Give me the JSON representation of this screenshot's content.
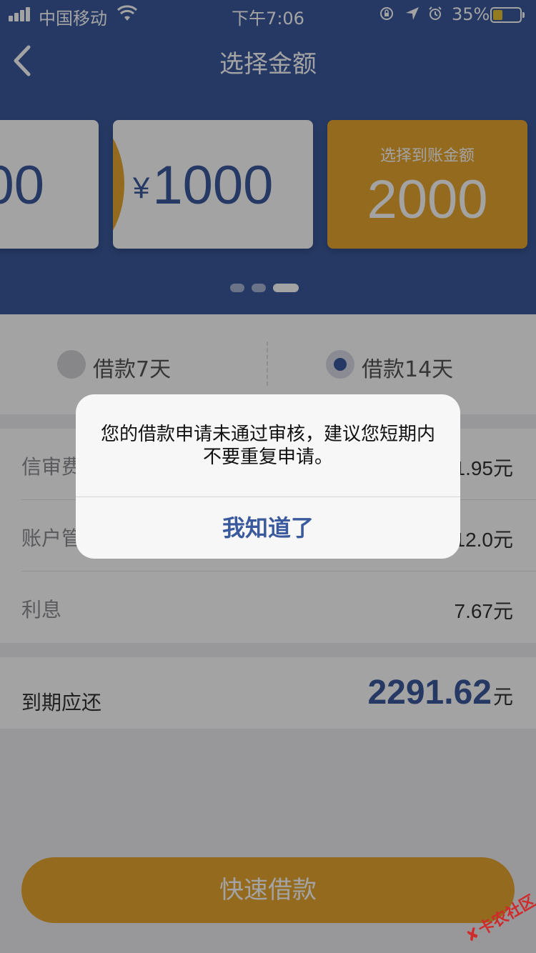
{
  "status_bar": {
    "carrier": "中国移动",
    "time": "下午7:06",
    "battery_percent": "35%",
    "battery_level": 0.35,
    "icons": [
      "signal-icon",
      "wifi-icon",
      "rotation-lock-icon",
      "location-icon",
      "alarm-icon",
      "battery-icon"
    ]
  },
  "nav": {
    "title": "选择金额",
    "back_icon": "chevron-left-icon"
  },
  "amount_cards": {
    "cards": [
      {
        "amount": "00",
        "currency": ""
      },
      {
        "amount": "1000",
        "currency": "¥"
      },
      {
        "amount": "2000",
        "caption": "选择到账金额"
      }
    ],
    "selected_index": 2,
    "page_dots": 3,
    "active_dot": 2
  },
  "term_options": {
    "options": [
      {
        "label": "借款7天",
        "selected": false
      },
      {
        "label": "借款14天",
        "selected": true
      }
    ]
  },
  "fees": {
    "rows": [
      {
        "label": "信审费",
        "value": "1.95元"
      },
      {
        "label": "账户管",
        "value": "12.0元"
      },
      {
        "label": "利息",
        "value": "7.67元"
      }
    ]
  },
  "total": {
    "label": "到期应还",
    "amount": "2291.62",
    "unit": "元"
  },
  "cta": {
    "label": "快速借款"
  },
  "dialog": {
    "message": "您的借款申请未通过审核，建议您短期内不要重复申请。",
    "button_label": "我知道了"
  },
  "watermark": {
    "text": "卡农社区"
  },
  "colors": {
    "primary": "#3b5a9d",
    "accent": "#e8a630",
    "overlay": "rgba(0,0,0,0.36)"
  }
}
